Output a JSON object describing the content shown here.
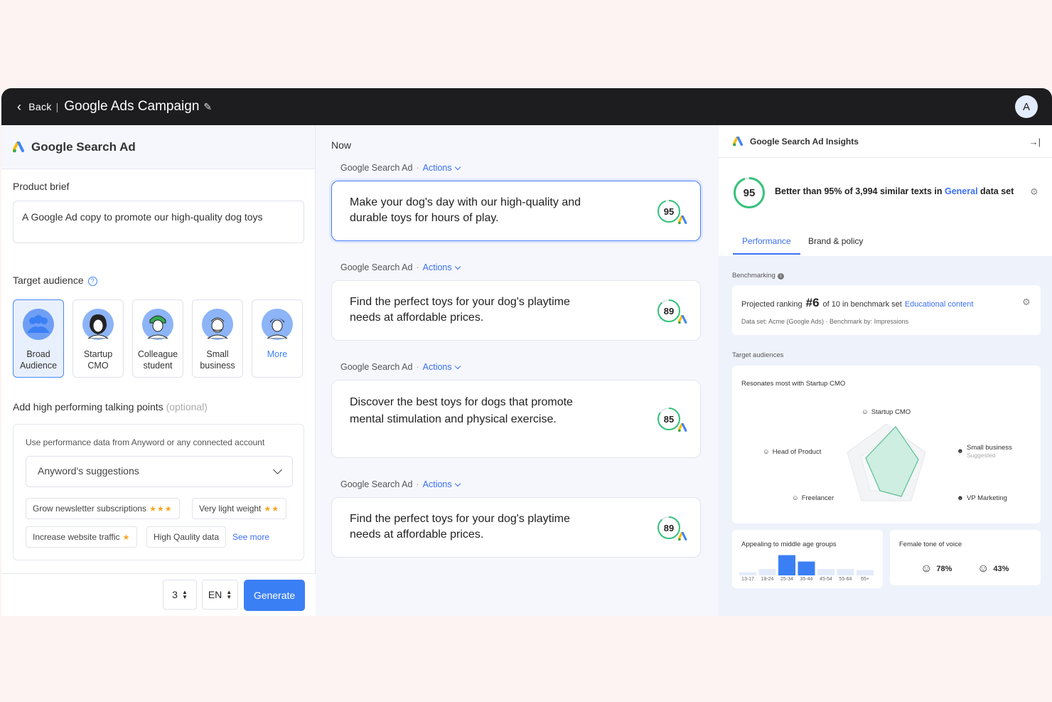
{
  "topbar": {
    "back_label": "Back",
    "separator": "|",
    "title": "Google Ads Campaign",
    "avatar_initial": "A"
  },
  "left": {
    "header": "Google Search Ad",
    "product_brief_label": "Product brief",
    "product_brief_value": "A Google Ad copy to promote our high-quality dog toys",
    "target_audience_label": "Target audience",
    "audiences": [
      {
        "line1": "Broad",
        "line2": "Audience",
        "selected": true
      },
      {
        "line1": "Startup",
        "line2": "CMO",
        "selected": false
      },
      {
        "line1": "Colleague",
        "line2": "student",
        "selected": false
      },
      {
        "line1": "Small",
        "line2": "business",
        "selected": false
      },
      {
        "line1": "More",
        "line2": "",
        "selected": false
      }
    ],
    "talking_points_label": "Add high performing talking points",
    "talking_points_optional": "(optional)",
    "perf_hint": "Use performance data from Anyword or any connected account",
    "suggestions_select": "Anyword's suggestions",
    "chips": [
      {
        "label": "Grow newsletter subscriptions",
        "stars": "★★★"
      },
      {
        "label": "Very light weight",
        "stars": "★★"
      },
      {
        "label": "Increase website traffic",
        "stars": "★"
      },
      {
        "label": "High Qaulity data",
        "stars": ""
      }
    ],
    "see_more": "See more",
    "count_value": "3",
    "language_value": "EN",
    "generate_label": "Generate"
  },
  "middle": {
    "now_label": "Now",
    "ads": [
      {
        "type": "Google Search Ad",
        "actions": "Actions",
        "text": "Make your dog's day with our high-quality and durable toys for hours of play.",
        "score": "95",
        "selected": true
      },
      {
        "type": "Google Search Ad",
        "actions": "Actions",
        "text": "Find the perfect toys for your dog's playtime needs at affordable prices.",
        "score": "89",
        "selected": false
      },
      {
        "type": "Google Search Ad",
        "actions": "Actions",
        "text": "Discover the best toys for dogs that promote mental stimulation and physical exercise.",
        "score": "85",
        "selected": false
      },
      {
        "type": "Google Search Ad",
        "actions": "Actions",
        "text": "Find the perfect toys for your dog's playtime needs at affordable prices.",
        "score": "89",
        "selected": false
      }
    ]
  },
  "right": {
    "header": "Google Search Ad Insights",
    "score": "95",
    "better_pre": "Better than 95% of 3,994 similar texts in ",
    "better_link": "General",
    "better_post": " data set",
    "tabs": [
      "Performance",
      "Brand & policy"
    ],
    "benchmarking_label": "Benchmarking",
    "projected_pre": "Projected ranking",
    "projected_rank": "#6",
    "projected_post": "of 10 in benchmark set",
    "projected_link": "Educational content",
    "dataset_line": "Data set: Acme (Google Ads)  ·  Benchmark by: Impressions",
    "target_audiences_label": "Target audiences",
    "resonates": "Resonates most with Startup CMO",
    "radar": {
      "startup_cmo": "Startup CMO",
      "head_of_product": "Head of Product",
      "small_business": "Small business",
      "small_business_sub": "Suggested",
      "freelancer": "Freelancer",
      "vp_marketing": "VP Marketing"
    },
    "age_title": "Appealing to middle age groups",
    "age_groups": [
      "13-17",
      "18-24",
      "25-34",
      "35-44",
      "45-54",
      "55-64",
      "65+"
    ],
    "age_values": [
      0.15,
      0.3,
      0.95,
      0.65,
      0.3,
      0.3,
      0.25
    ],
    "voice_title": "Female tone of voice",
    "voice_female": "78%",
    "voice_male": "43%"
  },
  "colors": {
    "accent": "#3b7ff5",
    "score_green": "#34c37a",
    "topbar": "#1d1d1f"
  }
}
